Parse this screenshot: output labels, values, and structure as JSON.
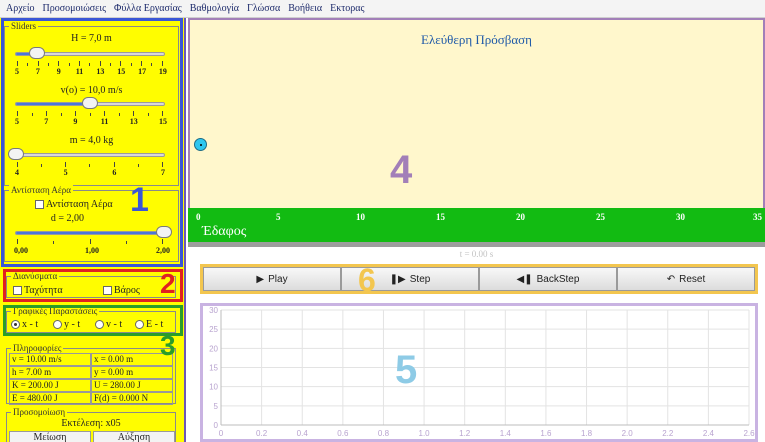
{
  "menu": [
    "Αρχείο",
    "Προσομοιώσεις",
    "Φύλλα Εργασίας",
    "Βαθμολογία",
    "Γλώσσα",
    "Βοήθεια",
    "Εκτορας"
  ],
  "sliders": {
    "legend": "Sliders",
    "height": {
      "label": "H = 7,0 m",
      "ticks": [
        "5",
        "7",
        "9",
        "11",
        "13",
        "15",
        "17",
        "19"
      ],
      "min": 5,
      "max": 19,
      "value": 7.0
    },
    "velocity": {
      "label": "v(o) = 10,0 m/s",
      "ticks": [
        "5",
        "7",
        "9",
        "11",
        "13",
        "15"
      ],
      "min": 5,
      "max": 15,
      "value": 10.0
    },
    "mass": {
      "label": "m = 4,0 kg",
      "ticks": [
        "4",
        "5",
        "6",
        "7"
      ],
      "min": 4,
      "max": 7,
      "value": 4.0
    }
  },
  "air_resistance": {
    "legend": "Αντίσταση Αέρα",
    "checkbox_label": "Αντίσταση Αέρα",
    "checked": false,
    "d_label": "d = 2,00",
    "ticks": [
      "0,00",
      "1,00",
      "2,00"
    ],
    "min": 0,
    "max": 2,
    "value": 2.0
  },
  "vectors": {
    "legend": "Διανύσματα",
    "velocity_label": "Ταχύτητα",
    "velocity_checked": false,
    "weight_label": "Βάρος",
    "weight_checked": false
  },
  "graphs": {
    "legend": "Γραφικές Παραστάσεις",
    "options": [
      "x - t",
      "y - t",
      "v - t",
      "E - t"
    ],
    "selected": 0
  },
  "info": {
    "legend": "Πληροφορίες",
    "rows": [
      [
        "v = 10.00 m/s",
        "x = 0.00 m"
      ],
      [
        "h = 7.00 m",
        "y = 0.00 m"
      ],
      [
        "K = 200.00 J",
        "U = 280.00 J"
      ],
      [
        "E = 480.00 J",
        "F(d) = 0.000 N"
      ]
    ]
  },
  "simulation": {
    "legend": "Προσομοίωση",
    "execution": "Εκτέλεση: x05",
    "decrease": "Μείωση",
    "increase": "Αύξηση"
  },
  "scene": {
    "title": "Ελεύθερη Πρόσβαση",
    "ground_label": "Έδαφος",
    "ground_ticks": [
      "0",
      "5",
      "10",
      "15",
      "20",
      "25",
      "30",
      "35"
    ],
    "time_label": "t = 0.00 s"
  },
  "controls": {
    "play": "Play",
    "step": "Step",
    "backstep": "BackStep",
    "reset": "Reset"
  },
  "plot": {
    "y_ticks": [
      "30",
      "25",
      "20",
      "15",
      "10",
      "5",
      "0"
    ],
    "x_ticks": [
      "0",
      "0.2",
      "0.4",
      "0.6",
      "0.8",
      "1.0",
      "1.2",
      "1.4",
      "1.6",
      "1.8",
      "2.0",
      "2.2",
      "2.4",
      "2.6"
    ]
  },
  "annotations": [
    "1",
    "2",
    "3",
    "4",
    "5",
    "6"
  ],
  "colors": {
    "panel_bg": "#fffd00",
    "ground": "#12bb12",
    "scene_bg": "#fff7cc",
    "title": "#1f5aa8",
    "ball": "#2ec7ef",
    "box1": "#3a56d6",
    "box2": "#e02121",
    "box3": "#2a9d2a",
    "box4": "#a27fb8",
    "box5": "#c9b3e2",
    "box6": "#f3c64f"
  }
}
